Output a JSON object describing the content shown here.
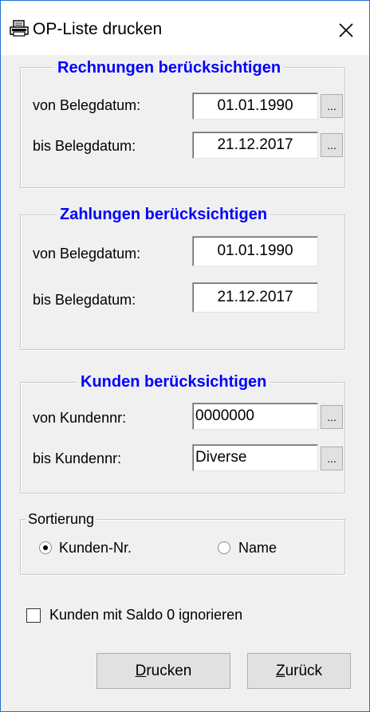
{
  "window": {
    "title": "OP-Liste drucken",
    "close_label": "✕",
    "icon": "printer-icon"
  },
  "rechnungen": {
    "title": "Rechnungen berücksichtigen",
    "von_label": "von Belegdatum:",
    "von_value": "01.01.1990",
    "bis_label": "bis Belegdatum:",
    "bis_value": "21.12.2017",
    "dots": "..."
  },
  "zahlungen": {
    "title": "Zahlungen berücksichtigen",
    "von_label": "von Belegdatum:",
    "von_value": "01.01.1990",
    "bis_label": "bis Belegdatum:",
    "bis_value": "21.12.2017"
  },
  "kunden": {
    "title": "Kunden berücksichtigen",
    "von_label": "von Kundennr:",
    "von_value": "0000000",
    "bis_label": "bis Kundennr:",
    "bis_value": "Diverse",
    "dots": "..."
  },
  "sortierung": {
    "title": "Sortierung",
    "options": [
      {
        "label": "Kunden-Nr.",
        "selected": true
      },
      {
        "label": "Name",
        "selected": false
      }
    ]
  },
  "saldo_checkbox": {
    "label": "Kunden mit Saldo 0 ignorieren",
    "checked": false
  },
  "buttons": {
    "drucken_first": "D",
    "drucken_rest": "rucken",
    "zurueck_first": "Z",
    "zurueck_rest": "urück"
  }
}
